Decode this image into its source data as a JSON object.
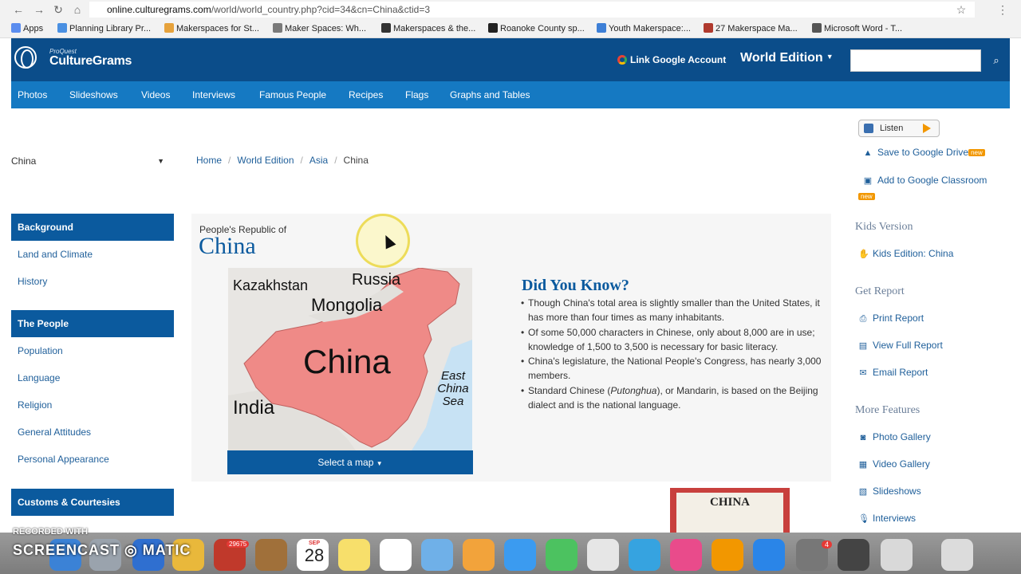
{
  "browser": {
    "url_host": "online.culturegrams.com",
    "url_path": "/world/world_country.php?cid=34&cn=China&ctid=3",
    "bookmarks": [
      {
        "label": "Apps",
        "color": "#5b8def"
      },
      {
        "label": "Planning Library Pr...",
        "color": "#4a90e2"
      },
      {
        "label": "Makerspaces for St...",
        "color": "#e6a23c"
      },
      {
        "label": "Maker Spaces: Wh...",
        "color": "#7a7a7a"
      },
      {
        "label": "Makerspaces & the...",
        "color": "#333333"
      },
      {
        "label": "Roanoke County sp...",
        "color": "#222222"
      },
      {
        "label": "Youth Makerspace:...",
        "color": "#3d7fd6"
      },
      {
        "label": "27 Makerspace Ma...",
        "color": "#b03a2e"
      },
      {
        "label": "Microsoft Word - T...",
        "color": "#555555"
      }
    ]
  },
  "header": {
    "logo_small": "ProQuest",
    "logo_text": "CultureGrams",
    "google_link": "Link Google Account",
    "edition": "World Edition",
    "search_placeholder": ""
  },
  "nav": [
    "Photos",
    "Slideshows",
    "Videos",
    "Interviews",
    "Famous People",
    "Recipes",
    "Flags",
    "Graphs and Tables"
  ],
  "sidebar": {
    "country_select": "China",
    "sections": [
      {
        "title": "Background",
        "items": [
          "Land and Climate",
          "History"
        ]
      },
      {
        "title": "The People",
        "items": [
          "Population",
          "Language",
          "Religion",
          "General Attitudes",
          "Personal Appearance"
        ]
      },
      {
        "title": "Customs & Courtesies",
        "items": []
      }
    ]
  },
  "breadcrumb": [
    "Home",
    "World Edition",
    "Asia",
    "China"
  ],
  "main": {
    "subtitle": "People's Republic of",
    "title": "China",
    "map_labels": [
      "Kazakhstan",
      "Russia",
      "Mongolia",
      "China",
      "India",
      "East China Sea"
    ],
    "map_button": "Select a map",
    "dyk_title": "Did You Know?",
    "facts": [
      "Though China's total area is slightly smaller than the United States, it has more than four times as many inhabitants.",
      "Of some 50,000 characters in Chinese, only about 8,000 are in use; knowledge of 1,500 to 3,500 is necessary for basic literacy.",
      "China's legislature, the National People's Congress, has nearly 3,000 members.",
      "Standard Chinese (Putonghua), or Mandarin, is based on the Beijing dialect and is the national language."
    ],
    "report_image_text": "CHINA"
  },
  "right": {
    "listen": "Listen",
    "save_drive": "Save to Google Drive",
    "add_classroom": "Add to Google Classroom",
    "new_badge": "new",
    "kids_head": "Kids Version",
    "kids_link": "Kids Edition: China",
    "report_head": "Get Report",
    "report_links": [
      "Print Report",
      "View Full Report",
      "Email Report"
    ],
    "features_head": "More Features",
    "feature_links": [
      "Photo Gallery",
      "Video Gallery",
      "Slideshows",
      "Interviews"
    ]
  },
  "overlay": {
    "rec1": "RECORDED WITH",
    "rec2": "SCREENCAST",
    "rec3": "MATIC",
    "badge_mail": "29675",
    "badge_appstore": "4",
    "cal_day": "28",
    "cal_month": "SEP"
  },
  "colors": {
    "header_blue": "#0b4d8a",
    "nav_blue": "#1579c2",
    "accent_orange": "#f29700",
    "map_china": "#ef8a87"
  }
}
